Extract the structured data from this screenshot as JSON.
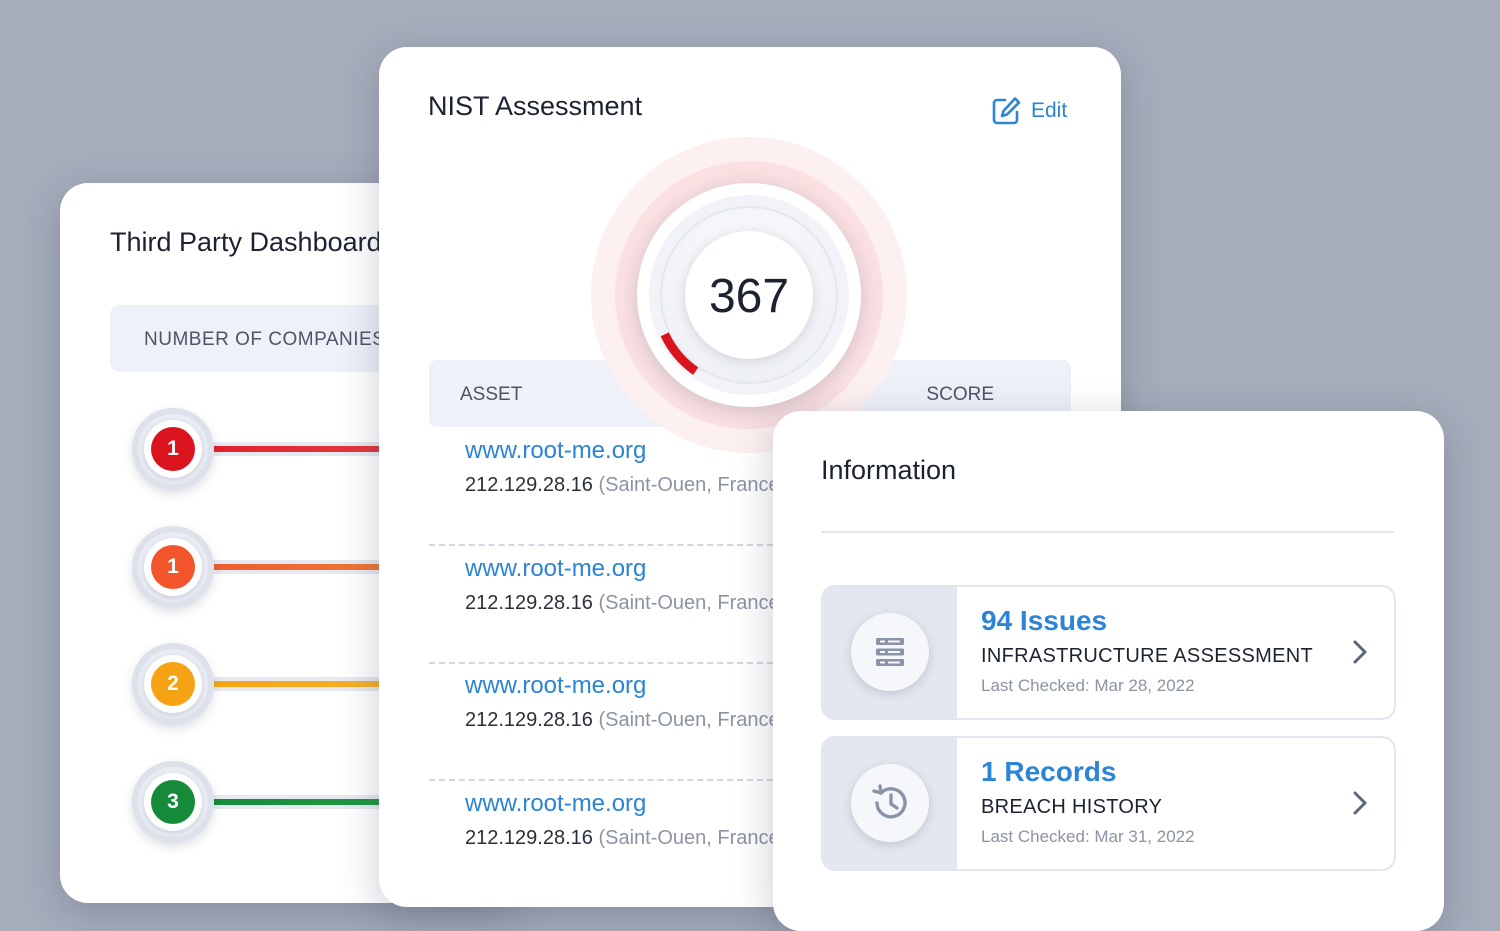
{
  "third_party": {
    "title": "Third Party Dashboard",
    "header": "NUMBER OF COMPANIES",
    "rows": [
      {
        "count": "1",
        "color": "#d9141c",
        "bar_from": "#e3202a",
        "bar_to": "#e34a4a"
      },
      {
        "count": "1",
        "color": "#f2552c",
        "bar_from": "#ee5b2f",
        "bar_to": "#f08a3a"
      },
      {
        "count": "2",
        "color": "#f5a314",
        "bar_from": "#f5a314",
        "bar_to": "#f5b93a"
      },
      {
        "count": "3",
        "color": "#158b3a",
        "bar_from": "#158b3a",
        "bar_to": "#2ba04a"
      }
    ]
  },
  "nist": {
    "title": "NIST Assessment",
    "edit_label": "Edit",
    "score": "367",
    "columns": {
      "asset": "ASSET",
      "score": "SCORE"
    },
    "assets": [
      {
        "domain": "www.root-me.org",
        "ip": "212.129.28.16",
        "location": "(Saint-Ouen, France)"
      },
      {
        "domain": "www.root-me.org",
        "ip": "212.129.28.16",
        "location": "(Saint-Ouen, France)"
      },
      {
        "domain": "www.root-me.org",
        "ip": "212.129.28.16",
        "location": "(Saint-Ouen, France)"
      },
      {
        "domain": "www.root-me.org",
        "ip": "212.129.28.16",
        "location": "(Saint-Ouen, France)"
      }
    ]
  },
  "information": {
    "title": "Information",
    "items": [
      {
        "count": "94 Issues",
        "name": "INFRASTRUCTURE ASSESSMENT",
        "last_checked": "Last Checked: Mar 28, 2022",
        "icon": "server-list-icon"
      },
      {
        "count": "1 Records",
        "name": "BREACH HISTORY",
        "last_checked": "Last Checked: Mar 31, 2022",
        "icon": "history-icon"
      }
    ]
  },
  "colors": {
    "accent": "#2b84d6",
    "gauge_red": "#d9141c"
  }
}
